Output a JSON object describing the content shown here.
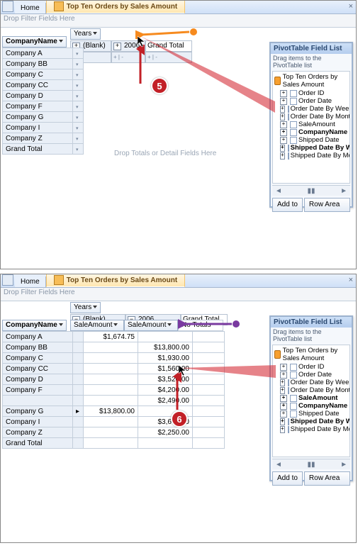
{
  "tabs": {
    "home": "Home",
    "active": "Top Ten Orders by Sales Amount"
  },
  "filter_hint": "Drop Filter Fields Here",
  "detail_hint": "Drop Totals or Detail Fields Here",
  "col_field": "Years",
  "cols1": {
    "blank": "(Blank)",
    "y2006": "2006",
    "grand": "Grand Total"
  },
  "row_field": "CompanyName",
  "rows1": [
    "Company A",
    "Company BB",
    "Company C",
    "Company CC",
    "Company D",
    "Company F",
    "Company G",
    "Company I",
    "Company Z",
    "Grand Total"
  ],
  "fieldlist": {
    "title": "PivotTable Field List",
    "sub": "Drag items to the PivotTable list",
    "root": "Top Ten Orders by Sales Amount",
    "items1": [
      {
        "label": "Order ID",
        "bold": false
      },
      {
        "label": "Order Date",
        "bold": false
      },
      {
        "label": "Order Date By Week",
        "bold": false
      },
      {
        "label": "Order Date By Month",
        "bold": false
      },
      {
        "label": "SaleAmount",
        "bold": false
      },
      {
        "label": "CompanyName",
        "bold": true
      },
      {
        "label": "Shipped Date",
        "bold": false
      },
      {
        "label": "Shipped Date By Week",
        "bold": true
      },
      {
        "label": "Shipped Date By Month",
        "bold": false
      }
    ],
    "items2": [
      {
        "label": "Order ID",
        "bold": false
      },
      {
        "label": "Order Date",
        "bold": false
      },
      {
        "label": "Order Date By Week",
        "bold": false
      },
      {
        "label": "Order Date By Month",
        "bold": false
      },
      {
        "label": "SaleAmount",
        "bold": true
      },
      {
        "label": "CompanyName",
        "bold": true
      },
      {
        "label": "Shipped Date",
        "bold": false
      },
      {
        "label": "Shipped Date By Week",
        "bold": true
      },
      {
        "label": "Shipped Date By Month",
        "bold": false
      }
    ],
    "addto": "Add to",
    "rowarea": "Row Area"
  },
  "step5": "5",
  "step6": "6",
  "s2": {
    "value_field": "SaleAmount",
    "no_totals": "No Totals",
    "rows": [
      {
        "name": "Company A",
        "blank": "$1,674.75",
        "y2006": ""
      },
      {
        "name": "Company BB",
        "blank": "",
        "y2006": "$13,800.00"
      },
      {
        "name": "Company C",
        "blank": "",
        "y2006": "$1,930.00"
      },
      {
        "name": "Company CC",
        "blank": "",
        "y2006": "$1,560.00"
      },
      {
        "name": "Company D",
        "blank": "",
        "y2006": "$3,520.00"
      },
      {
        "name": "Company F",
        "blank": "",
        "y2006": "$4,200.00"
      },
      {
        "name": "",
        "blank": "",
        "y2006": "$2,490.00"
      },
      {
        "name": "Company G",
        "blank": "$13,800.00",
        "y2006": "",
        "marker": true
      },
      {
        "name": "Company I",
        "blank": "",
        "y2006": "$3,690.00"
      },
      {
        "name": "Company Z",
        "blank": "",
        "y2006": "$2,250.00"
      },
      {
        "name": "Grand Total",
        "blank": "",
        "y2006": ""
      }
    ]
  }
}
